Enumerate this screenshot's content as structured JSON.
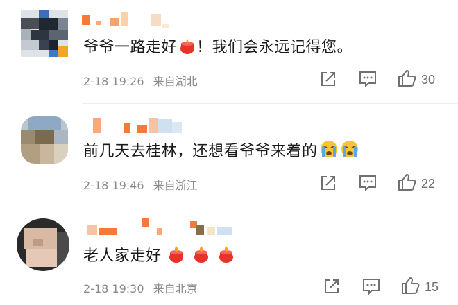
{
  "comments": [
    {
      "text": "爷爷一路走好",
      "text_after": "！我们会永远记得您。",
      "time": "2-18 19:26",
      "location": "来自湖北",
      "likes": "30",
      "icons": [
        "candle-emoji"
      ]
    },
    {
      "text": "前几天去桂林，还想看爷爷来着的",
      "time": "2-18 19:46",
      "location": "来自浙江",
      "likes": "22",
      "icons": [
        "crying-face-emoji",
        "crying-face-emoji"
      ]
    },
    {
      "text": "老人家走好",
      "time": "2-18 19:30",
      "location": "来自北京",
      "likes": "15",
      "icons": [
        "candle-emoji",
        "candle-emoji",
        "candle-emoji"
      ]
    }
  ],
  "action_icons": [
    "share-icon",
    "comment-icon",
    "like-thumb-icon"
  ],
  "colors": {
    "text": "#1a1a1a",
    "meta": "#8a8a8a",
    "name_orange": "#f47a3b",
    "candle_red": "#e8322a"
  }
}
